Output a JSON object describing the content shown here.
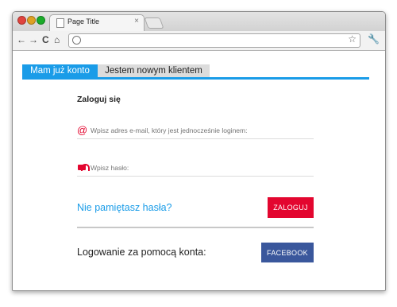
{
  "browser": {
    "tab_title": "Page Title",
    "tab_close": "×",
    "url": ""
  },
  "page": {
    "tabs": [
      {
        "label": "Mam już konto",
        "active": true
      },
      {
        "label": "Jestem nowym klientem",
        "active": false
      }
    ],
    "heading": "Zaloguj się",
    "email_placeholder": "Wpisz adres e-mail, który jest jednocześnie loginem:",
    "email_icon": "@",
    "password_placeholder": "Wpisz hasło:",
    "forgot_password": "Nie pamiętasz hasła?",
    "login_button": "ZALOGUJ",
    "social_label": "Logowanie za pomocą konta:",
    "facebook_button": "FACEBOOK"
  },
  "colors": {
    "accent": "#1a9ce8",
    "login": "#e3062f",
    "facebook": "#3a579c"
  }
}
